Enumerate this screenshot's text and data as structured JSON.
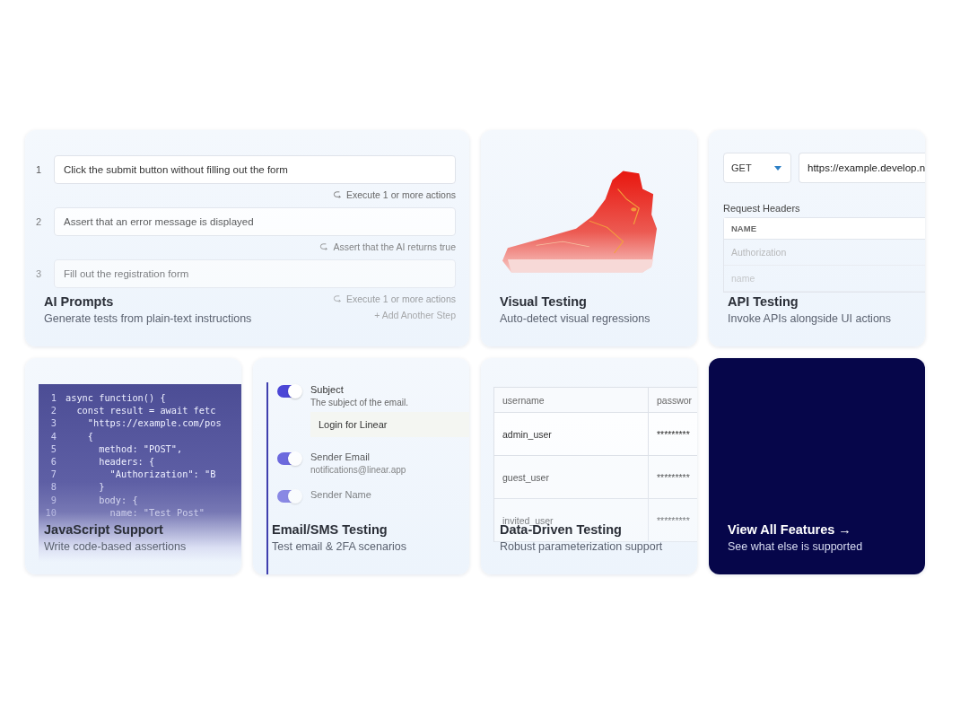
{
  "cards": [
    {
      "kind": "prompts",
      "title": "AI Prompts",
      "description": "Generate tests from plain-text instructions",
      "steps": [
        {
          "number": "1",
          "text": "Click the submit button without filling out the form",
          "hint": "Execute 1 or more actions"
        },
        {
          "number": "2",
          "text": "Assert that an error message is displayed",
          "hint": "Assert that the AI returns true"
        },
        {
          "number": "3",
          "text": "Fill out the registration form",
          "hint": "Execute 1 or more actions"
        }
      ],
      "add_step": "+ Add Another Step"
    },
    {
      "kind": "visual",
      "title": "Visual Testing",
      "description": "Auto-detect visual regressions"
    },
    {
      "kind": "api",
      "title": "API Testing",
      "description": "Invoke APIs alongside UI actions",
      "method": "GET",
      "url": "https://example.develop.n",
      "section_label": "Request Headers",
      "header_column": "NAME",
      "rows": [
        "Authorization",
        "name"
      ]
    },
    {
      "kind": "code",
      "title": "JavaScript Support",
      "description": "Write code-based assertions",
      "lines": [
        {
          "number": "1",
          "code": "async function() {"
        },
        {
          "number": "2",
          "code": "  const result = await fetc"
        },
        {
          "number": "3",
          "code": "    \"https://example.com/pos"
        },
        {
          "number": "4",
          "code": "    {"
        },
        {
          "number": "5",
          "code": "      method: \"POST\","
        },
        {
          "number": "6",
          "code": "      headers: {"
        },
        {
          "number": "7",
          "code": "        \"Authorization\": \"B"
        },
        {
          "number": "8",
          "code": "      }"
        },
        {
          "number": "9",
          "code": "      body: {"
        },
        {
          "number": "10",
          "code": "        name: \"Test Post\""
        }
      ]
    },
    {
      "kind": "email",
      "title": "Email/SMS Testing",
      "description": "Test email & 2FA scenarios",
      "fields": [
        {
          "label": "Subject",
          "description": "The subject of the email.",
          "value": "Login for Linear",
          "on": true
        },
        {
          "label": "Sender Email",
          "description": "notifications@linear.app",
          "on": true
        },
        {
          "label": "Sender Name",
          "on": true
        }
      ]
    },
    {
      "kind": "data",
      "title": "Data-Driven Testing",
      "description": "Robust parameterization support",
      "columns": [
        "username",
        "passwor"
      ],
      "rows": [
        [
          "admin_user",
          "*********"
        ],
        [
          "guest_user",
          "*********"
        ],
        [
          "invited_user",
          "*********"
        ]
      ]
    },
    {
      "kind": "cta",
      "title": "View All Features →",
      "description": "See what else is supported"
    }
  ]
}
